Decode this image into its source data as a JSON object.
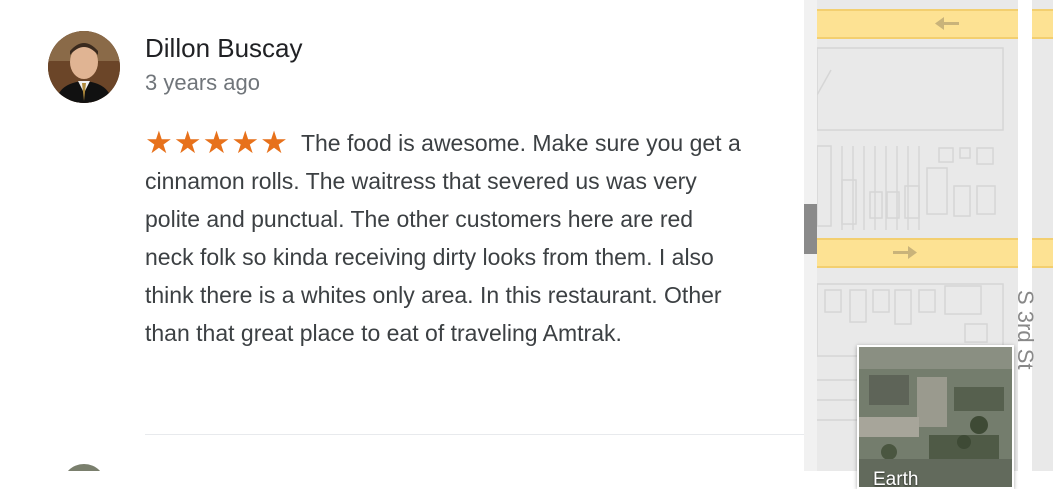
{
  "review": {
    "author": "Dillon Buscay",
    "date": "3 years ago",
    "rating": 5,
    "stars": "★★★★★",
    "text": "The food is awesome. Make sure you get a cinnamon rolls. The waitress that severed us was very polite and punctual. The other customers here are red neck folk so kinda receiving dirty looks from them. I also think there is a whites only area. In this restaurant. Other than that great place to eat of traveling Amtrak."
  },
  "map": {
    "street_label": "S 3rd St",
    "layer_toggle_label": "Earth"
  },
  "colors": {
    "star": "#e7711b",
    "author": "#202124",
    "date": "#70757a",
    "body": "#3c4043",
    "road": "#fde293",
    "map_bg": "#e9e9e9"
  },
  "icons": [
    "star-icon",
    "road-arrow-left-icon",
    "road-arrow-right-icon"
  ]
}
